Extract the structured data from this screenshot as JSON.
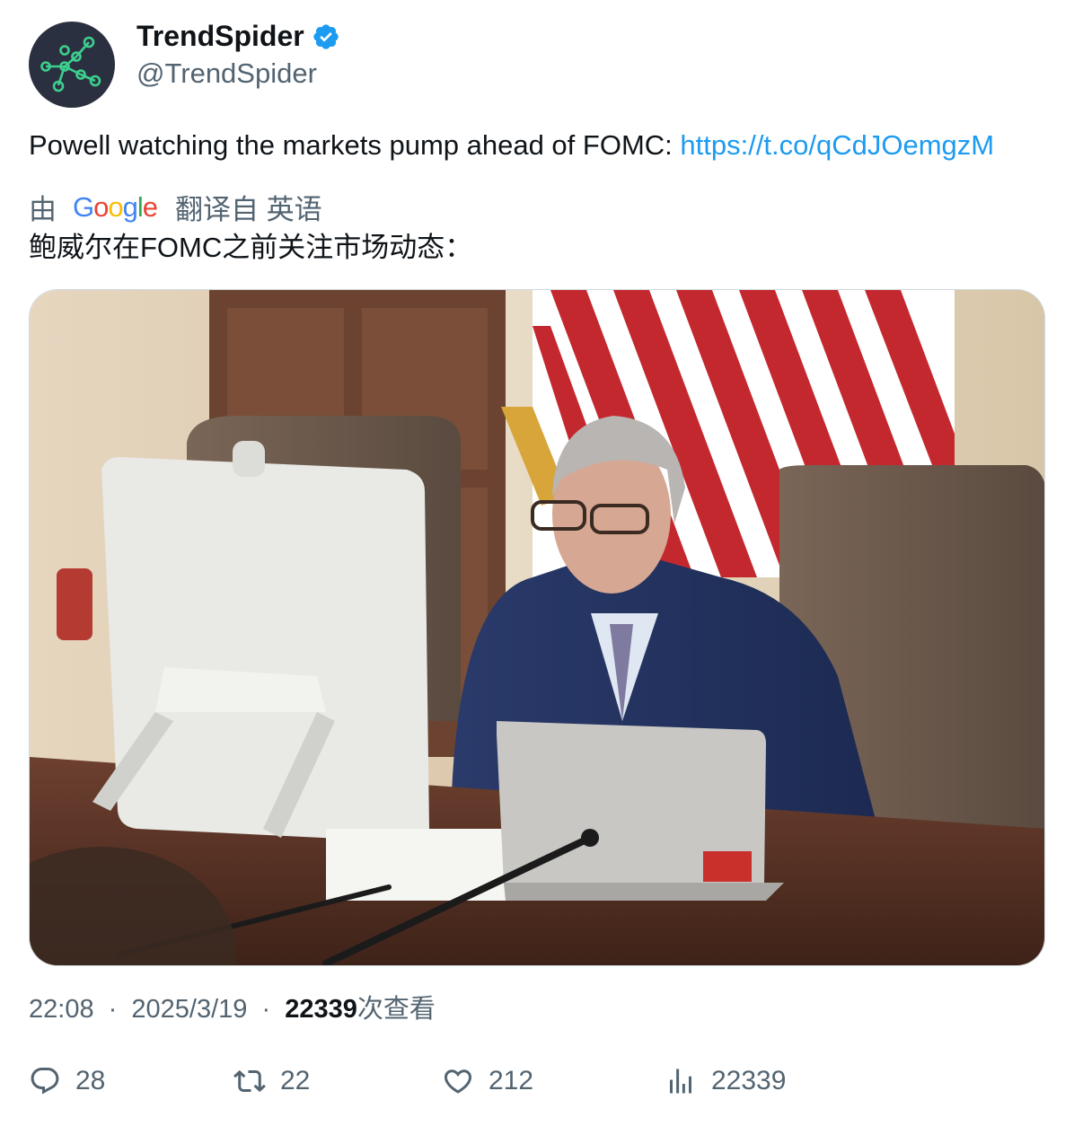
{
  "account": {
    "display_name": "TrendSpider",
    "handle": "@TrendSpider",
    "verified": true,
    "avatar_bg": "#2b3040",
    "avatar_accent": "#3ccf8e"
  },
  "tweet": {
    "text": "Powell watching the markets pump ahead of FOMC: ",
    "link": "https://t.co/qCdJOemgzM"
  },
  "translation": {
    "by_label": "由",
    "provider": "Google",
    "from_label": "翻译自 英语",
    "translated_text": "鲍威尔在FOMC之前关注市场动态："
  },
  "media": {
    "icon": "photo",
    "alt": ""
  },
  "meta": {
    "time": "22:08",
    "separator": "·",
    "date": "2025/3/19",
    "views_count": "22339",
    "views_label": "次查看"
  },
  "actions": {
    "replies": "28",
    "retweets": "22",
    "likes": "212",
    "views": "22339"
  },
  "colors": {
    "link": "#1d9bf0",
    "secondary_text": "#536471",
    "primary_text": "#0f1419",
    "verified": "#1d9bf0"
  }
}
